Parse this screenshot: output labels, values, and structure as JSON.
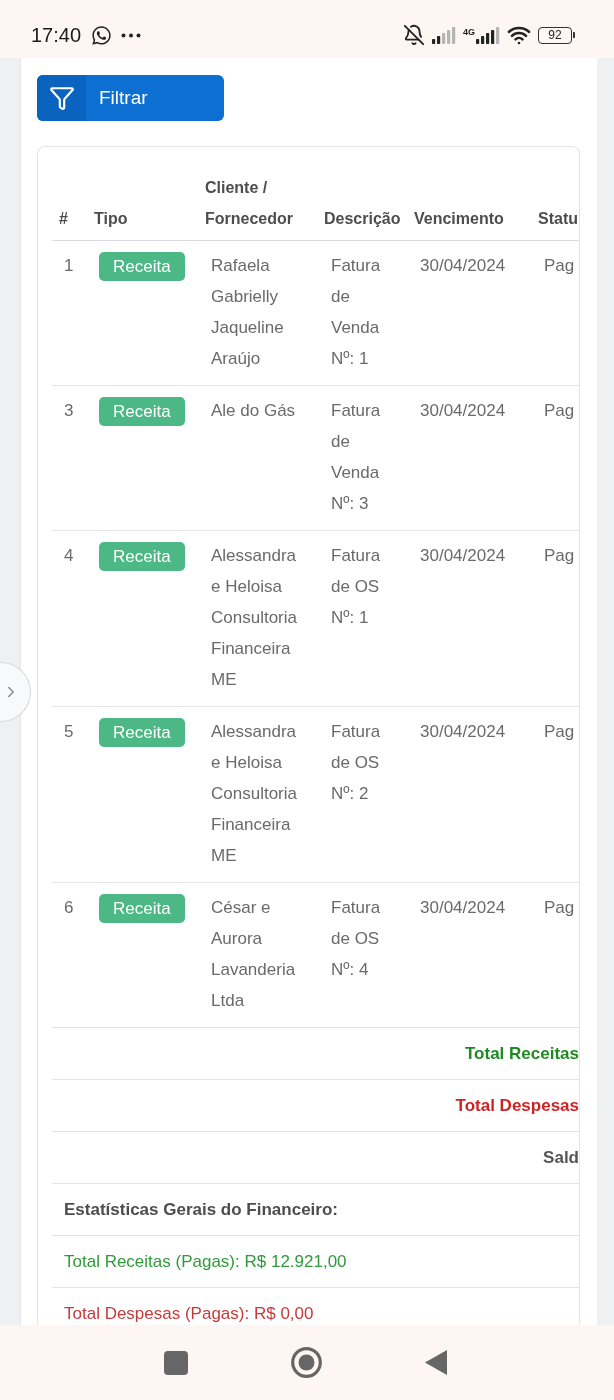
{
  "status_bar": {
    "time": "17:40",
    "network": "4G",
    "battery": "92"
  },
  "filter_button": {
    "label": "Filtrar"
  },
  "table": {
    "columns": [
      "#",
      "Tipo",
      "Cliente / Fornecedor",
      "Descrição",
      "Vencimento",
      "Statu"
    ],
    "rows": [
      {
        "number": "1",
        "type": "Receita",
        "client": "Rafaela Gabrielly Jaqueline Araújo",
        "description": "Fatura de Venda Nº: 1",
        "due_date": "30/04/2024",
        "status": "Pag"
      },
      {
        "number": "3",
        "type": "Receita",
        "client": "Ale do Gás",
        "description": "Fatura de Venda Nº: 3",
        "due_date": "30/04/2024",
        "status": "Pag"
      },
      {
        "number": "4",
        "type": "Receita",
        "client": "Alessandra e Heloisa Consultoria Financeira ME",
        "description": "Fatura de OS Nº: 1",
        "due_date": "30/04/2024",
        "status": "Pag"
      },
      {
        "number": "5",
        "type": "Receita",
        "client": "Alessandra e Heloisa Consultoria Financeira ME",
        "description": "Fatura de OS Nº: 2",
        "due_date": "30/04/2024",
        "status": "Pag"
      },
      {
        "number": "6",
        "type": "Receita",
        "client": "César e Aurora Lavanderia Ltda",
        "description": "Fatura de OS Nº: 4",
        "due_date": "30/04/2024",
        "status": "Pag"
      }
    ],
    "totals": [
      {
        "kind": "income",
        "label": "Total Receitas"
      },
      {
        "kind": "expense",
        "label": "Total Despesas"
      },
      {
        "kind": "balance",
        "label": "Sald"
      }
    ]
  },
  "statistics": {
    "title": "Estatísticas Gerais do Financeiro:",
    "items": [
      {
        "kind": "income",
        "text": "Total Receitas (Pagas): R$ 12.921,00"
      },
      {
        "kind": "expense",
        "text": "Total Despesas (Pagas): R$ 0,00"
      }
    ]
  }
}
